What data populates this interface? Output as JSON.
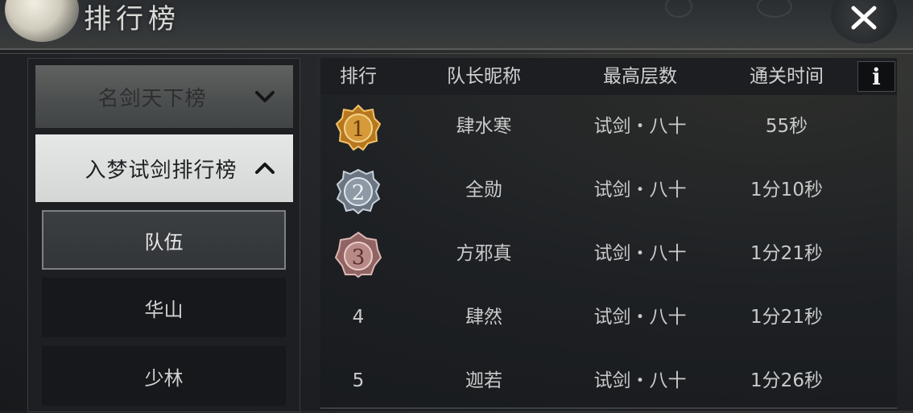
{
  "window": {
    "title": "排行榜"
  },
  "sidebar": {
    "categories": [
      {
        "label": "名剑天下榜",
        "expanded": false
      },
      {
        "label": "入梦试剑排行榜",
        "expanded": true
      }
    ],
    "sub_items": [
      {
        "label": "队伍",
        "active": true
      },
      {
        "label": "华山",
        "active": false
      },
      {
        "label": "少林",
        "active": false
      }
    ]
  },
  "table": {
    "headers": {
      "rank": "排行",
      "captain": "队长昵称",
      "floor": "最高层数",
      "time": "通关时间"
    },
    "info_label": "i",
    "rows": [
      {
        "rank": "1",
        "captain": "肆水寒",
        "floor": "试剑・八十",
        "time": "55秒",
        "medal": "gold"
      },
      {
        "rank": "2",
        "captain": "全勋",
        "floor": "试剑・八十",
        "time": "1分10秒",
        "medal": "silver"
      },
      {
        "rank": "3",
        "captain": "方邪真",
        "floor": "试剑・八十",
        "time": "1分21秒",
        "medal": "bronze"
      },
      {
        "rank": "4",
        "captain": "肆然",
        "floor": "试剑・八十",
        "time": "1分21秒",
        "medal": ""
      },
      {
        "rank": "5",
        "captain": "迦若",
        "floor": "试剑・八十",
        "time": "1分26秒",
        "medal": ""
      }
    ]
  },
  "colors": {
    "gold": "#c9892c",
    "silver": "#8e99a5",
    "bronze": "#b78a88"
  }
}
